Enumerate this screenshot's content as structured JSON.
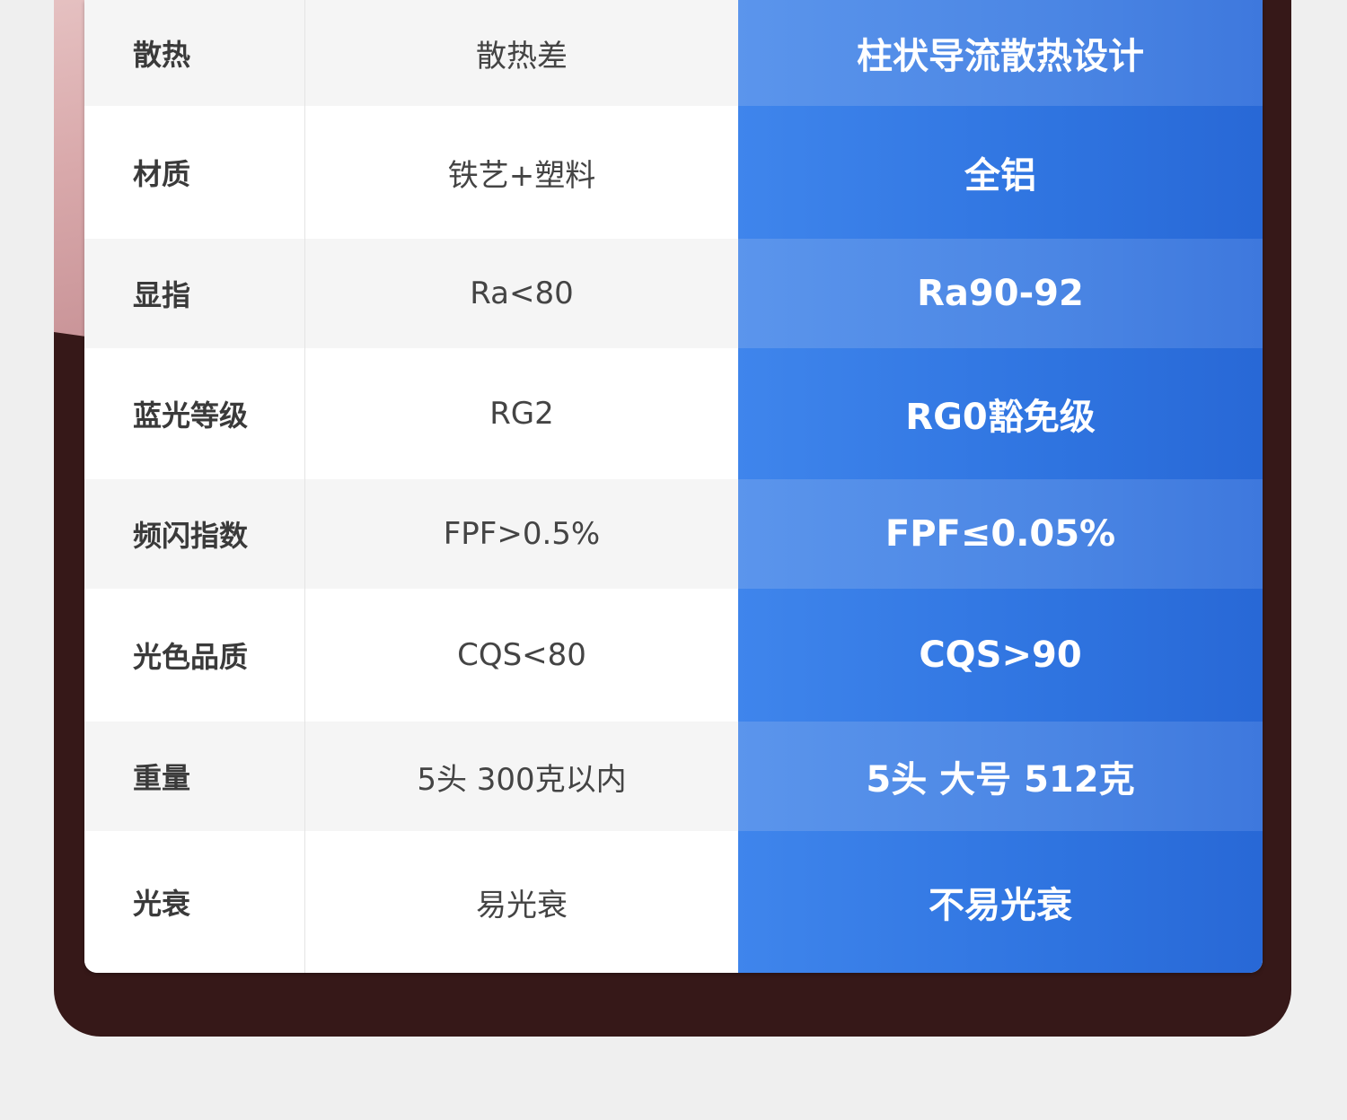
{
  "table": {
    "rows": [
      {
        "label": "散热",
        "compare": "散热差",
        "ours": "柱状导流散热设计"
      },
      {
        "label": "材质",
        "compare": "铁艺+塑料",
        "ours": "全铝"
      },
      {
        "label": "显指",
        "compare": "Ra<80",
        "ours": "Ra90-92"
      },
      {
        "label": "蓝光等级",
        "compare": "RG2",
        "ours": "RG0豁免级"
      },
      {
        "label": "频闪指数",
        "compare": "FPF>0.5%",
        "ours": "FPF≤0.05%"
      },
      {
        "label": "光色品质",
        "compare": "CQS<80",
        "ours": "CQS>90"
      },
      {
        "label": "重量",
        "compare": "5头 300克以内",
        "ours": "5头 大号 512克"
      },
      {
        "label": "光衰",
        "compare": "易光衰",
        "ours": "不易光衰"
      }
    ]
  },
  "colors": {
    "panel": "#361818",
    "highlight_column": "#3f85ec",
    "background": "#efefef"
  }
}
